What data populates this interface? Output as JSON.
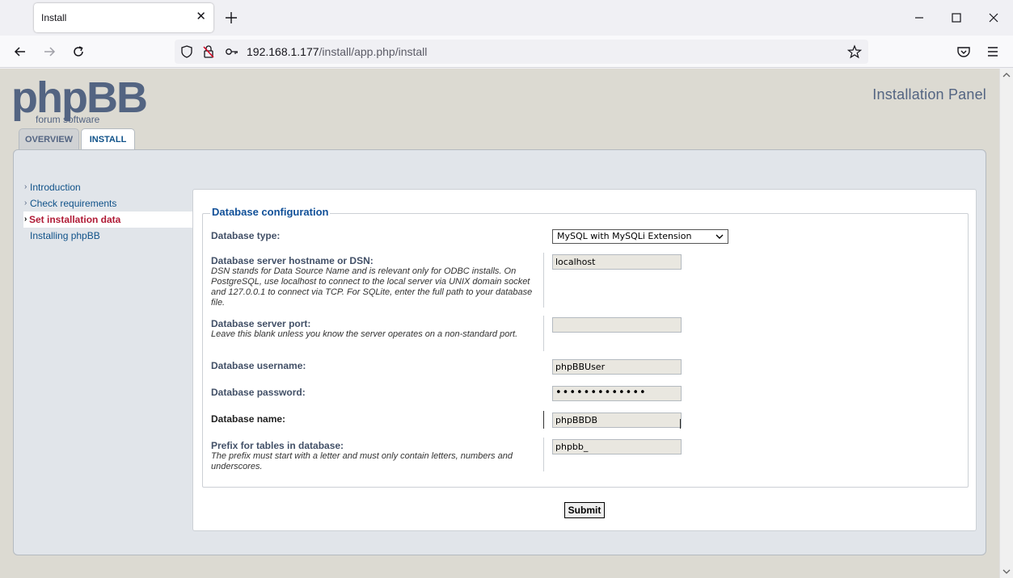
{
  "browser": {
    "tab_title": "Install",
    "url_host": "192.168.1.177",
    "url_path": "/install/app.php/install"
  },
  "header": {
    "logo_text": "phpBB",
    "logo_subtext": "forum software",
    "panel_title": "Installation Panel"
  },
  "tabs": [
    {
      "label": "OVERVIEW"
    },
    {
      "label": "INSTALL"
    }
  ],
  "menu": {
    "items": [
      {
        "label": "Introduction"
      },
      {
        "label": "Check requirements"
      },
      {
        "label": "Set installation data"
      },
      {
        "label": "Installing phpBB"
      }
    ]
  },
  "form": {
    "legend": "Database configuration",
    "db_type": {
      "label": "Database type:",
      "value": "MySQL with MySQLi Extension"
    },
    "db_host": {
      "label": "Database server hostname or DSN:",
      "description": "DSN stands for Data Source Name and is relevant only for ODBC installs. On PostgreSQL, use localhost to connect to the local server via UNIX domain socket and 127.0.0.1 to connect via TCP. For SQLite, enter the full path to your database file.",
      "value": "localhost"
    },
    "db_port": {
      "label": "Database server port:",
      "description": "Leave this blank unless you know the server operates on a non-standard port.",
      "value": ""
    },
    "db_user": {
      "label": "Database username:",
      "value": "phpBBUser"
    },
    "db_password": {
      "label": "Database password:",
      "value": "•••••••••••••"
    },
    "db_name": {
      "label": "Database name:",
      "value": "phpBBDB"
    },
    "db_prefix": {
      "label": "Prefix for tables in database:",
      "description": "The prefix must start with a letter and must only contain letters, numbers and underscores.",
      "value": "phpbb_"
    },
    "submit_label": "Submit"
  },
  "colors": {
    "page_bg": "#dcdad2",
    "panel_bg": "#e1e5ea",
    "link": "#105289",
    "active_menu": "#b01b36",
    "legend": "#115098",
    "label": "#425067"
  },
  "icons": [
    "close-icon",
    "plus-icon",
    "minimize-icon",
    "maximize-icon",
    "back-icon",
    "forward-icon",
    "reload-icon",
    "shield-icon",
    "permissions-icon",
    "key-icon",
    "star-icon",
    "pocket-icon",
    "menu-icon",
    "chevron-down-icon"
  ]
}
